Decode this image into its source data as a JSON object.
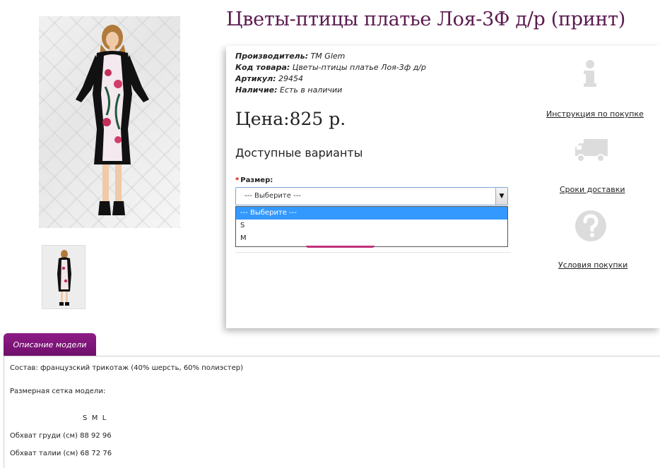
{
  "product": {
    "title": "Цветы-птицы платье Лоя-3Ф д/р (принт)",
    "meta": [
      {
        "key": "Производитель:",
        "value": " TM Glem"
      },
      {
        "key": "Код товара:",
        "value": " Цветы-птицы платье Лоя-3ф д/р"
      },
      {
        "key": "Артикул:",
        "value": " 29454"
      },
      {
        "key": "Наличие:",
        "value": " Есть в наличии"
      }
    ],
    "price": "Цена:825 р.",
    "variants_title": "Доступные варианты",
    "size_required_mark": "*",
    "size_label": "Размер:",
    "select_value": "--- Выберите ---",
    "select_arrow": "▼",
    "options": [
      "--- Выберите ---",
      "S",
      "M"
    ]
  },
  "side_links": {
    "instructions": "Инструкция по покупке",
    "delivery": "Сроки доставки",
    "terms": "Условия покупки"
  },
  "colors": {
    "title": "#5b1a4f",
    "accent": "#8e1b87",
    "selected_option": "#3399ff",
    "icon_gray": "#dcdcdc"
  },
  "tabs": {
    "description": "Описание модели"
  },
  "description": {
    "composition": "Состав: французский трикотаж (40% шерсть, 60% полиэстер)",
    "size_chart_title": "Размерная сетка модели:",
    "size_header": "S  M  L",
    "bust": "Обхват груди (см) 88 92 96",
    "waist": "Обхват талии (см) 68 72 76"
  }
}
